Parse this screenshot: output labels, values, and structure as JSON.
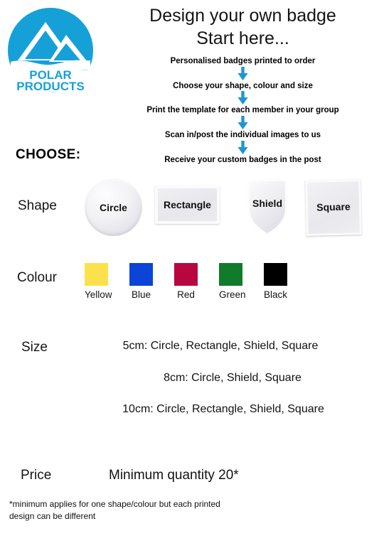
{
  "logo": {
    "brand_line1": "POLAR",
    "brand_line2": "PRODUCTS",
    "circle_color": "#16A0D8",
    "mountain_color": "#FFFFFF"
  },
  "heading": {
    "line1": "Design your own badge",
    "line2": "Start here..."
  },
  "steps": {
    "arrow_color": "#1E96D4",
    "items": [
      "Personalised badges printed to order",
      "Choose your shape, colour and size",
      "Print the template for each member in your group",
      "Scan in/post the individual images to us",
      "Receive your custom badges in the post"
    ]
  },
  "choose": {
    "heading": "CHOOSE:",
    "shape": {
      "label": "Shape",
      "options": [
        {
          "name": "Circle",
          "shape": "circle"
        },
        {
          "name": "Rectangle",
          "shape": "rectangle"
        },
        {
          "name": "Shield",
          "shape": "shield"
        },
        {
          "name": "Square",
          "shape": "square"
        }
      ]
    },
    "colour": {
      "label": "Colour",
      "options": [
        {
          "name": "Yellow",
          "hex": "#FBE24C"
        },
        {
          "name": "Blue",
          "hex": "#0B44D6"
        },
        {
          "name": "Red",
          "hex": "#B8063F"
        },
        {
          "name": "Green",
          "hex": "#117A2B"
        },
        {
          "name": "Black",
          "hex": "#000000"
        }
      ]
    },
    "size": {
      "label": "Size",
      "lines": [
        "5cm: Circle, Rectangle, Shield, Square",
        "8cm: Circle, Shield, Square",
        "10cm: Circle, Rectangle, Shield, Square"
      ]
    },
    "price": {
      "label": "Price",
      "value": "Minimum quantity 20*"
    }
  },
  "footnote": {
    "text": "*minimum applies for one shape/colour but each printed design can be different"
  }
}
